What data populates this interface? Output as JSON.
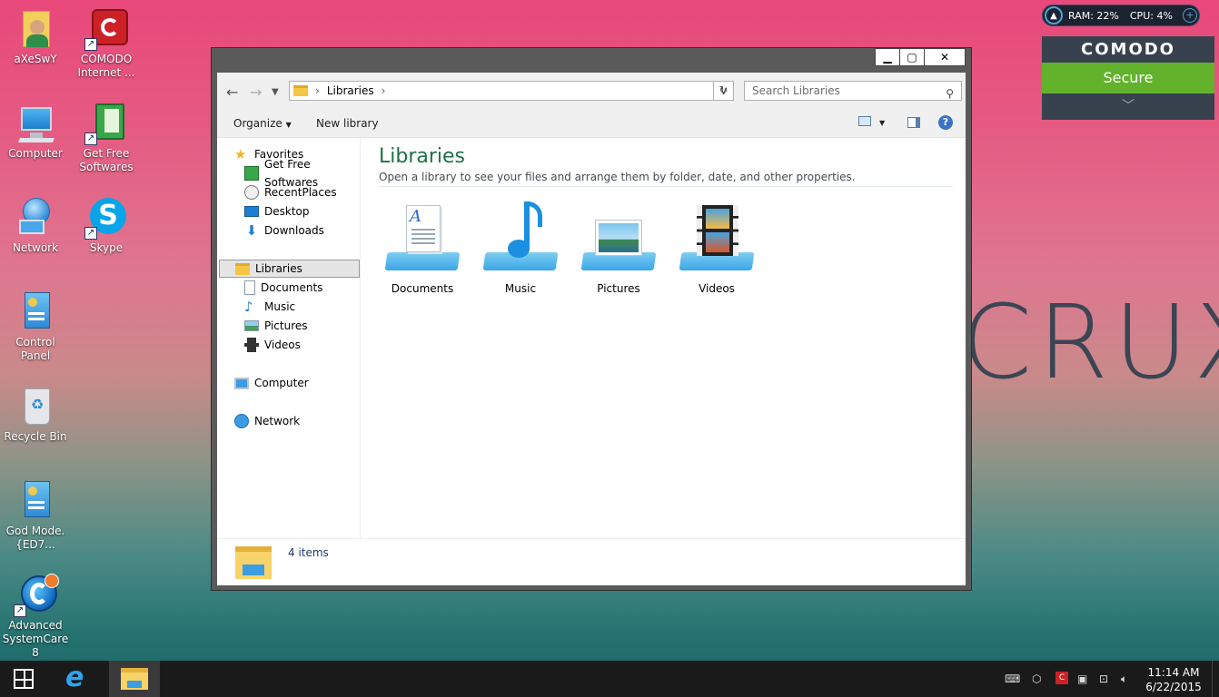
{
  "desktop": {
    "icons": [
      {
        "label": "aXeSwY"
      },
      {
        "label": "COMODO Internet ..."
      },
      {
        "label": "Computer"
      },
      {
        "label": "Get Free Softwares"
      },
      {
        "label": "Network"
      },
      {
        "label": "Skype"
      },
      {
        "label": "Control Panel"
      },
      {
        "label": "Recycle Bin"
      },
      {
        "label": "God Mode.{ED7..."
      },
      {
        "label": "Advanced SystemCare 8"
      }
    ],
    "wallpaper_text": "CRUX"
  },
  "widget": {
    "ram": "RAM: 22%",
    "cpu": "CPU: 4%",
    "brand": "COMODO",
    "status": "Secure",
    "secure_color": "#62b22b"
  },
  "window": {
    "address": {
      "crumb": "Libraries"
    },
    "search": {
      "placeholder": "Search Libraries"
    },
    "toolbar": {
      "organize": "Organize",
      "new_library": "New library"
    },
    "nav": {
      "favorites": "Favorites",
      "fav_items": [
        "Get Free Softwares",
        "RecentPlaces",
        "Desktop",
        "Downloads"
      ],
      "libraries": "Libraries",
      "lib_items": [
        "Documents",
        "Music",
        "Pictures",
        "Videos"
      ],
      "computer": "Computer",
      "network": "Network"
    },
    "content": {
      "title": "Libraries",
      "subtitle": "Open a library to see your files and arrange them by folder, date, and other properties.",
      "items": [
        "Documents",
        "Music",
        "Pictures",
        "Videos"
      ]
    },
    "status": {
      "count": "4 items"
    },
    "title_color": "#1e7145"
  },
  "taskbar": {
    "time": "11:14 AM",
    "date": "6/22/2015"
  }
}
